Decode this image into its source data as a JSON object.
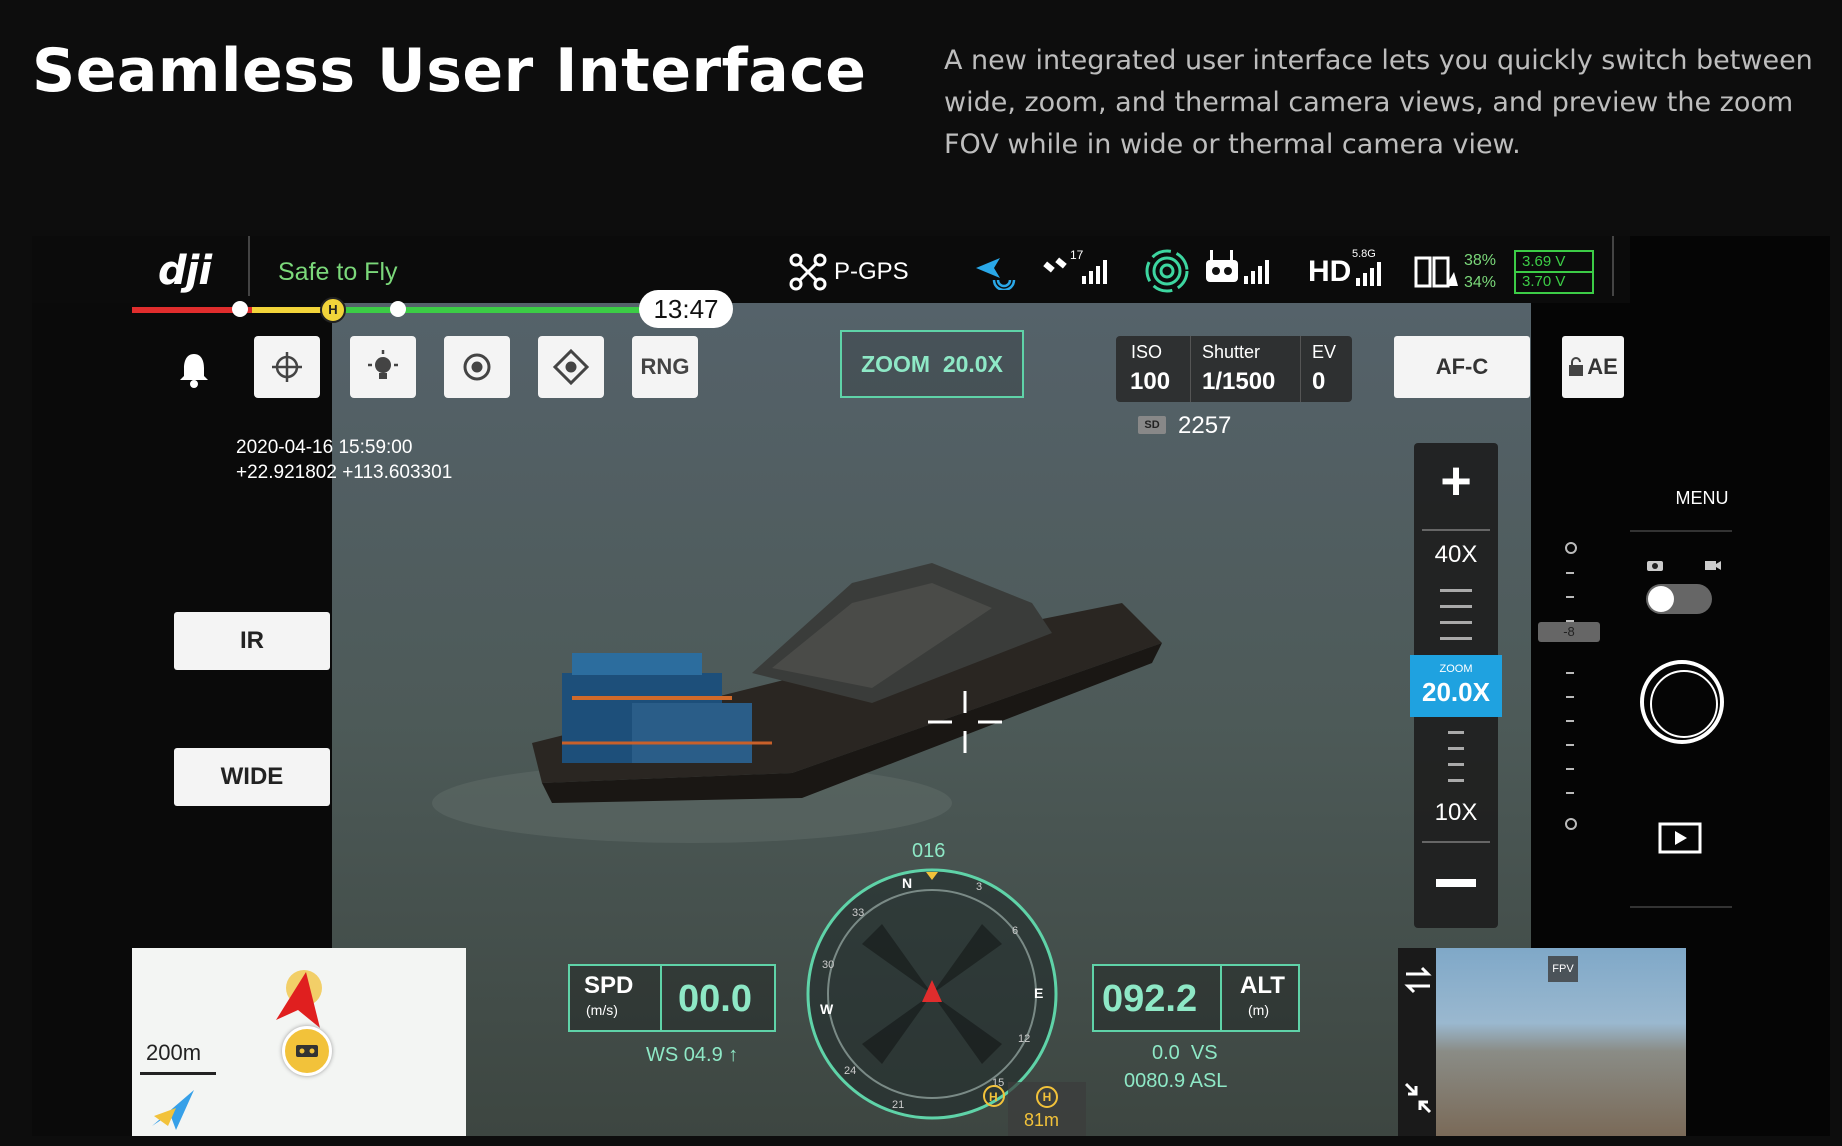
{
  "hero": {
    "title": "Seamless User Interface",
    "description": "A new integrated user interface lets you quickly switch between wide, zoom, and thermal camera views, and preview the zoom FOV while in wide or thermal camera view."
  },
  "topbar": {
    "brand": "dji",
    "flight_status": "Safe to Fly",
    "battery_time": "13:47",
    "gps_mode": "P-GPS",
    "satellite_count": "17",
    "transmission_label": "HD",
    "transmission_band": "5.8G",
    "battery_percent_1": "38%",
    "battery_percent_2": "34%",
    "voltage_1": "3.69 V",
    "voltage_2": "3.70 V",
    "more_label": "•••"
  },
  "toolbar": {
    "rng_label": "RNG",
    "zoom_indicator": "ZOOM  20.0X"
  },
  "exposure": {
    "iso_label": "ISO",
    "iso_value": "100",
    "shutter_label": "Shutter",
    "shutter_value": "1/1500",
    "ev_label": "EV",
    "ev_value": "0",
    "sd_label": "SD",
    "storage_count": "2257"
  },
  "focus": {
    "mode": "AF-C",
    "ae_lock": "AE"
  },
  "overlay": {
    "timestamp": "2020-04-16 15:59:00",
    "coordinates": "+22.921802 +113.603301"
  },
  "camera_buttons": {
    "ir_label": "IR",
    "wide_label": "WIDE"
  },
  "zoom_slider": {
    "max_label": "40X",
    "current_caption": "ZOOM",
    "current_value": "20.0X",
    "min_label": "10X",
    "plus": "+",
    "minus": "−"
  },
  "exposure_scale": {
    "value": "-8"
  },
  "right_panel": {
    "menu_label": "MENU"
  },
  "map": {
    "scale_label": "200m"
  },
  "telemetry": {
    "spd_label": "SPD",
    "spd_unit": "(m/s)",
    "spd_value": "00.0",
    "ws_label": "WS 04.9 ↑",
    "alt_value": "092.2",
    "alt_label": "ALT",
    "alt_unit": "(m)",
    "vs_label": "0.0  VS",
    "asl_label": "0080.9 ASL",
    "heading": "016",
    "home_distance": "81m"
  },
  "compass": {
    "n": "N",
    "e": "E",
    "w": "W",
    "labels": [
      "3",
      "6",
      "12",
      "15",
      "21",
      "24",
      "30",
      "33"
    ]
  },
  "fpv": {
    "label": "FPV"
  },
  "colors": {
    "accent_green": "#5fd3a8",
    "status_green": "#7bd87a",
    "zoom_blue": "#1fa2e0",
    "bar_red": "#e02d2d",
    "bar_yellow": "#f2d43a",
    "bar_green": "#3ccc46"
  }
}
